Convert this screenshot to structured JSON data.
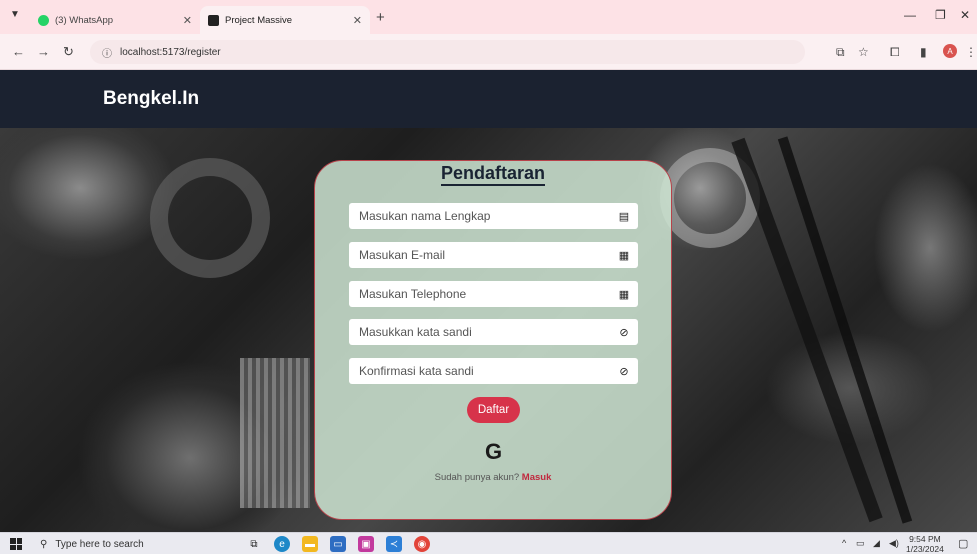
{
  "browser": {
    "tabs": [
      {
        "label": "(3) WhatsApp",
        "active": false
      },
      {
        "label": "Project Massive",
        "active": true
      }
    ],
    "url": "localhost:5173/register"
  },
  "app": {
    "brand": "Bengkel.In"
  },
  "form": {
    "title": "Pendaftaran",
    "fields": [
      {
        "placeholder": "Masukan nama Lengkap",
        "icon": "id-card-icon"
      },
      {
        "placeholder": "Masukan E-mail",
        "icon": "contact-icon"
      },
      {
        "placeholder": "Masukan Telephone",
        "icon": "contact-icon"
      },
      {
        "placeholder": "Masukkan kata sandi",
        "icon": "eye-slash-icon"
      },
      {
        "placeholder": "Konfirmasi kata sandi",
        "icon": "eye-slash-icon"
      }
    ],
    "submit_label": "Daftar",
    "google_glyph": "G",
    "login_prompt": "Sudah punya akun?",
    "login_link": "Masuk"
  },
  "taskbar": {
    "search_placeholder": "Type here to search",
    "time": "9:54 PM",
    "date": "1/23/2024"
  },
  "colors": {
    "header_bg": "#1b2230",
    "accent": "#d7334a",
    "card_bg": "#cde4d2"
  }
}
